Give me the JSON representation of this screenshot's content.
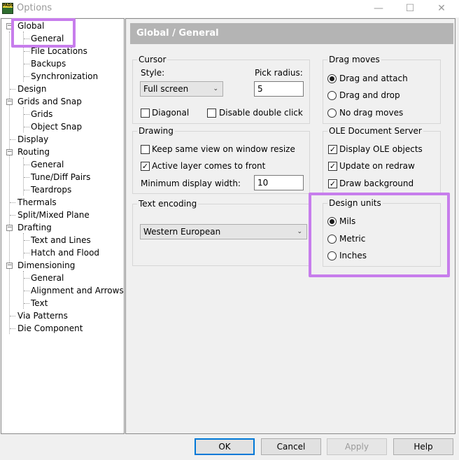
{
  "window": {
    "title": "Options",
    "app_icon_text": "PADS",
    "controls": {
      "minimize": "—",
      "maximize": "☐",
      "close": "✕"
    }
  },
  "tree": {
    "items": [
      {
        "label": "Global",
        "level": 0,
        "expander": "−"
      },
      {
        "label": "General",
        "level": 1,
        "selected": true
      },
      {
        "label": "File Locations",
        "level": 1
      },
      {
        "label": "Backups",
        "level": 1
      },
      {
        "label": "Synchronization",
        "level": 1
      },
      {
        "label": "Design",
        "level": 0
      },
      {
        "label": "Grids and Snap",
        "level": 0,
        "expander": "−"
      },
      {
        "label": "Grids",
        "level": 1
      },
      {
        "label": "Object Snap",
        "level": 1
      },
      {
        "label": "Display",
        "level": 0
      },
      {
        "label": "Routing",
        "level": 0,
        "expander": "−"
      },
      {
        "label": "General",
        "level": 1
      },
      {
        "label": "Tune/Diff Pairs",
        "level": 1
      },
      {
        "label": "Teardrops",
        "level": 1
      },
      {
        "label": "Thermals",
        "level": 0
      },
      {
        "label": "Split/Mixed Plane",
        "level": 0
      },
      {
        "label": "Drafting",
        "level": 0,
        "expander": "−"
      },
      {
        "label": "Text and Lines",
        "level": 1
      },
      {
        "label": "Hatch and Flood",
        "level": 1
      },
      {
        "label": "Dimensioning",
        "level": 0,
        "expander": "−"
      },
      {
        "label": "General",
        "level": 1
      },
      {
        "label": "Alignment and Arrows",
        "level": 1
      },
      {
        "label": "Text",
        "level": 1
      },
      {
        "label": "Via Patterns",
        "level": 0
      },
      {
        "label": "Die Component",
        "level": 0
      }
    ]
  },
  "header": {
    "title": "Global / General"
  },
  "cursor": {
    "legend": "Cursor",
    "style_label": "Style:",
    "style_value": "Full screen",
    "pick_radius_label": "Pick radius:",
    "pick_radius_value": "5",
    "diagonal_label": "Diagonal",
    "diagonal_checked": false,
    "disable_double_click_label": "Disable double click",
    "disable_double_click_checked": false
  },
  "drag_moves": {
    "legend": "Drag moves",
    "options": [
      "Drag and attach",
      "Drag and drop",
      "No drag moves"
    ],
    "selected": "Drag and attach"
  },
  "drawing": {
    "legend": "Drawing",
    "keep_same_view_label": "Keep same view on window resize",
    "keep_same_view_checked": false,
    "active_layer_label": "Active layer comes to front",
    "active_layer_checked": true,
    "min_display_width_label": "Minimum display width:",
    "min_display_width_value": "10"
  },
  "ole": {
    "legend": "OLE Document Server",
    "display_ole_label": "Display OLE objects",
    "display_ole_checked": true,
    "update_on_redraw_label": "Update on redraw",
    "update_on_redraw_checked": true,
    "draw_background_label": "Draw background",
    "draw_background_checked": true
  },
  "text_encoding": {
    "legend": "Text encoding",
    "value": "Western European"
  },
  "design_units": {
    "legend": "Design units",
    "options": [
      "Mils",
      "Metric",
      "Inches"
    ],
    "selected": "Mils"
  },
  "buttons": {
    "ok": "OK",
    "cancel": "Cancel",
    "apply": "Apply",
    "help": "Help"
  },
  "colors": {
    "highlight": "#c77dec",
    "header_bg": "#b4b4b4",
    "default_button_border": "#0078d7"
  },
  "icons": {
    "check": "✓",
    "dropdown": "⌄"
  }
}
